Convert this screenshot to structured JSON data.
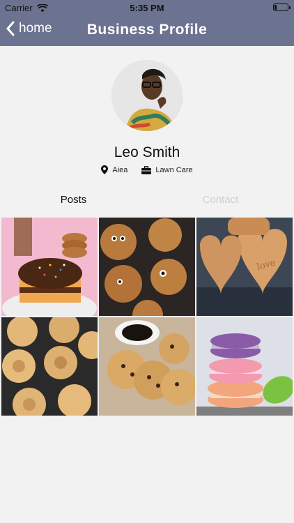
{
  "status_bar": {
    "carrier": "Carrier",
    "time": "5:35 PM",
    "battery_level": 0.2
  },
  "nav": {
    "back_label": "home",
    "title": "Business Profile"
  },
  "profile": {
    "name": "Leo Smith",
    "location": "Aiea",
    "category": "Lawn Care"
  },
  "tabs": [
    {
      "label": "Posts",
      "active": true
    },
    {
      "label": "Contact",
      "active": false
    }
  ],
  "posts": [
    {
      "icon": "frosted-cake-photo"
    },
    {
      "icon": "monster-cookies-photo"
    },
    {
      "icon": "heart-cookies-photo"
    },
    {
      "icon": "butter-cookies-photo"
    },
    {
      "icon": "chocolate-chip-cookies-photo"
    },
    {
      "icon": "macarons-photo"
    }
  ],
  "colors": {
    "nav_bg": "#6c7390",
    "tab_inactive": "#cfcfcf"
  }
}
